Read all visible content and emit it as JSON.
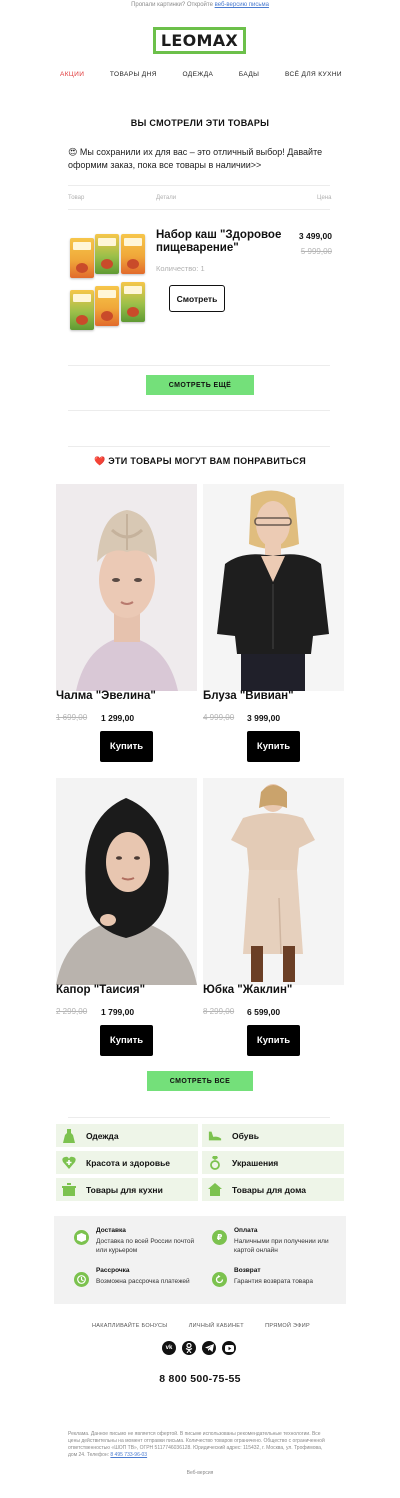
{
  "preheader": {
    "text": "Пропали картинки? Откройте",
    "link": "веб-версию письма"
  },
  "logo": {
    "text": "LEOMAX"
  },
  "nav": {
    "items": [
      {
        "label": "Акции",
        "active": true
      },
      {
        "label": "Товары дня",
        "active": false
      },
      {
        "label": "Одежда",
        "active": false
      },
      {
        "label": "Бады",
        "active": false
      },
      {
        "label": "Всё для кухни",
        "active": false
      }
    ]
  },
  "viewed": {
    "title": "Вы смотрели эти товары",
    "emoji": "😍",
    "text": "Мы сохранили их для вас – это отличный выбор! Давайте оформим заказ, пока все товары в наличии>>",
    "columns": {
      "product": "Товар",
      "details": "Детали",
      "price": "Цена"
    },
    "item": {
      "name": "Набор каш \"Здоровое пищеварение\"",
      "quantity": "Количество: 1",
      "price": "3 499,00",
      "old_price": "5 999,00",
      "button": "Смотреть"
    },
    "more_button": "Смотреть ещё"
  },
  "recommend": {
    "emoji": "❤️",
    "title": "Эти товары могут вам понравиться",
    "products": [
      {
        "name": "Чалма \"Эвелина\"",
        "old_price": "1 699,00",
        "price": "1 299,00",
        "button": "Купить"
      },
      {
        "name": "Блуза \"Вивиан\"",
        "old_price": "4 999,00",
        "price": "3 999,00",
        "button": "Купить"
      },
      {
        "name": "Капор \"Таисия\"",
        "old_price": "2 299,00",
        "price": "1 799,00",
        "button": "Купить"
      },
      {
        "name": "Юбка \"Жаклин\"",
        "old_price": "8 299,00",
        "price": "6 599,00",
        "button": "Купить"
      }
    ],
    "all_button": "Смотреть все"
  },
  "categories": [
    {
      "label": "Одежда",
      "icon": "dress-icon"
    },
    {
      "label": "Обувь",
      "icon": "shoe-icon"
    },
    {
      "label": "Красота и здоровье",
      "icon": "heart-plus-icon"
    },
    {
      "label": "Украшения",
      "icon": "ring-icon"
    },
    {
      "label": "Товары для кухни",
      "icon": "pot-icon"
    },
    {
      "label": "Товары для дома",
      "icon": "house-icon"
    }
  ],
  "info": [
    {
      "title": "Доставка",
      "text": "Доставка по всей России почтой или курьером",
      "icon": "box-icon"
    },
    {
      "title": "Оплата",
      "text": "Наличными при получении или картой онлайн",
      "icon": "ruble-icon"
    },
    {
      "title": "Рассрочка",
      "text": "Возможна рассрочка платежей",
      "icon": "clock-icon"
    },
    {
      "title": "Возврат",
      "text": "Гарантия возврата товара",
      "icon": "return-icon"
    }
  ],
  "footer": {
    "links": [
      "Накапливайте бонусы",
      "Личный кабинет",
      "Прямой эфир"
    ],
    "social": [
      {
        "label": "vk",
        "icon": "vk-icon"
      },
      {
        "label": "ok",
        "icon": "ok-icon"
      },
      {
        "label": "tg",
        "icon": "telegram-icon"
      },
      {
        "label": "yt",
        "icon": "youtube-icon"
      }
    ],
    "phone": "8 800 500-75-55",
    "legal": "Реклама. Данное письмо не является офертой. В письме использованы рекомендательные технологии. Все цены действительны на момент отправки письма. Количество товаров ограничено. Общество с ограниченной ответственностью «ШОП ТВ», ОГРН 5117746036128. Юридический адрес: 115432, г. Москва, ул. Трофимова, дом 24. Телефон:",
    "legal_phone": "8 495 733-96-03",
    "web_version": "Веб-версия"
  }
}
